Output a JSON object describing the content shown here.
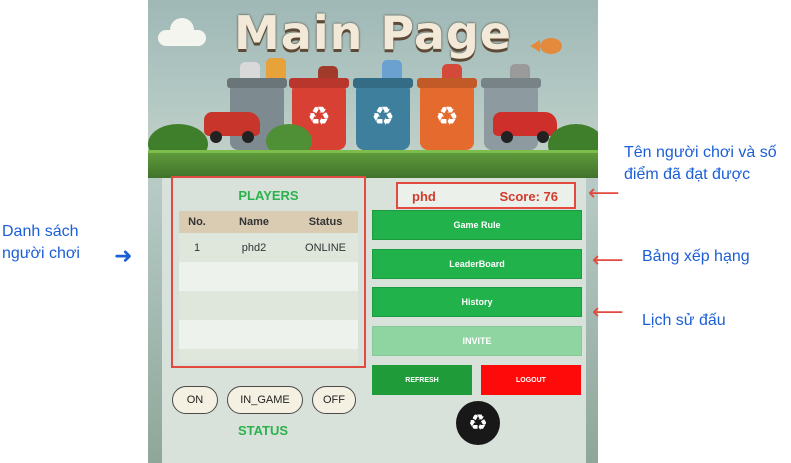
{
  "banner": {
    "title": "Main Page"
  },
  "players": {
    "title": "PLAYERS",
    "columns": [
      "No.",
      "Name",
      "Status"
    ],
    "rows": [
      {
        "no": "1",
        "name": "phd2",
        "status": "ONLINE"
      },
      {
        "no": "",
        "name": "",
        "status": ""
      },
      {
        "no": "",
        "name": "",
        "status": ""
      },
      {
        "no": "",
        "name": "",
        "status": ""
      },
      {
        "no": "",
        "name": "",
        "status": ""
      }
    ]
  },
  "status": {
    "label": "STATUS",
    "buttons": [
      "ON",
      "IN_GAME",
      "OFF"
    ]
  },
  "user": {
    "name": "phd",
    "score_text": "Score: 76"
  },
  "menu": {
    "game_rule": "Game Rule",
    "leaderboard": "LeaderBoard",
    "history": "History",
    "invite": "INVITE",
    "refresh": "REFRESH",
    "logout": "LOGOUT"
  },
  "annotations": {
    "player_list": "Danh sách người chơi",
    "player_info": "Tên người chơi và số điểm đã đạt được",
    "leaderboard": "Bảng xếp hạng",
    "history": "Lịch sử đấu"
  },
  "icons": {
    "recycle": "recycle-icon",
    "arrow_left": "arrow-left-icon",
    "arrow_right": "arrow-right-icon"
  },
  "colors": {
    "accent_green": "#22b24c",
    "title_green": "#2bb24c",
    "highlight_red": "#e24a3f",
    "score_red": "#d33a2c",
    "logout_red": "#ff0a0a",
    "note_blue": "#1a5fd6"
  }
}
